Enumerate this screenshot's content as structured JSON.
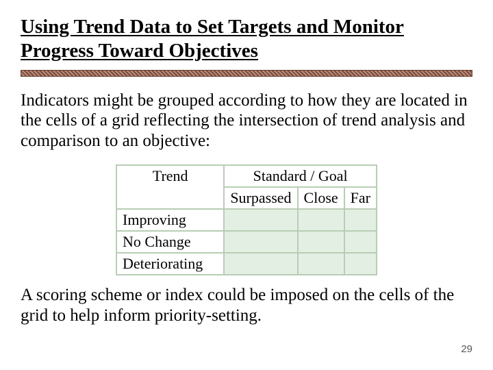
{
  "title": "Using Trend Data to Set Targets and Monitor Progress Toward Objectives",
  "intro": "Indicators might be grouped according to how they are located in the cells of a grid reflecting the intersection of trend analysis and comparison to an objective:",
  "table": {
    "corner": "Trend",
    "col_group": "Standard / Goal",
    "cols": [
      "Surpassed",
      "Close",
      "Far"
    ],
    "rows": [
      "Improving",
      "No Change",
      "Deteriorating"
    ]
  },
  "outro": "A scoring scheme or index could be imposed on the cells of the grid to help inform priority-setting.",
  "page_number": "29"
}
